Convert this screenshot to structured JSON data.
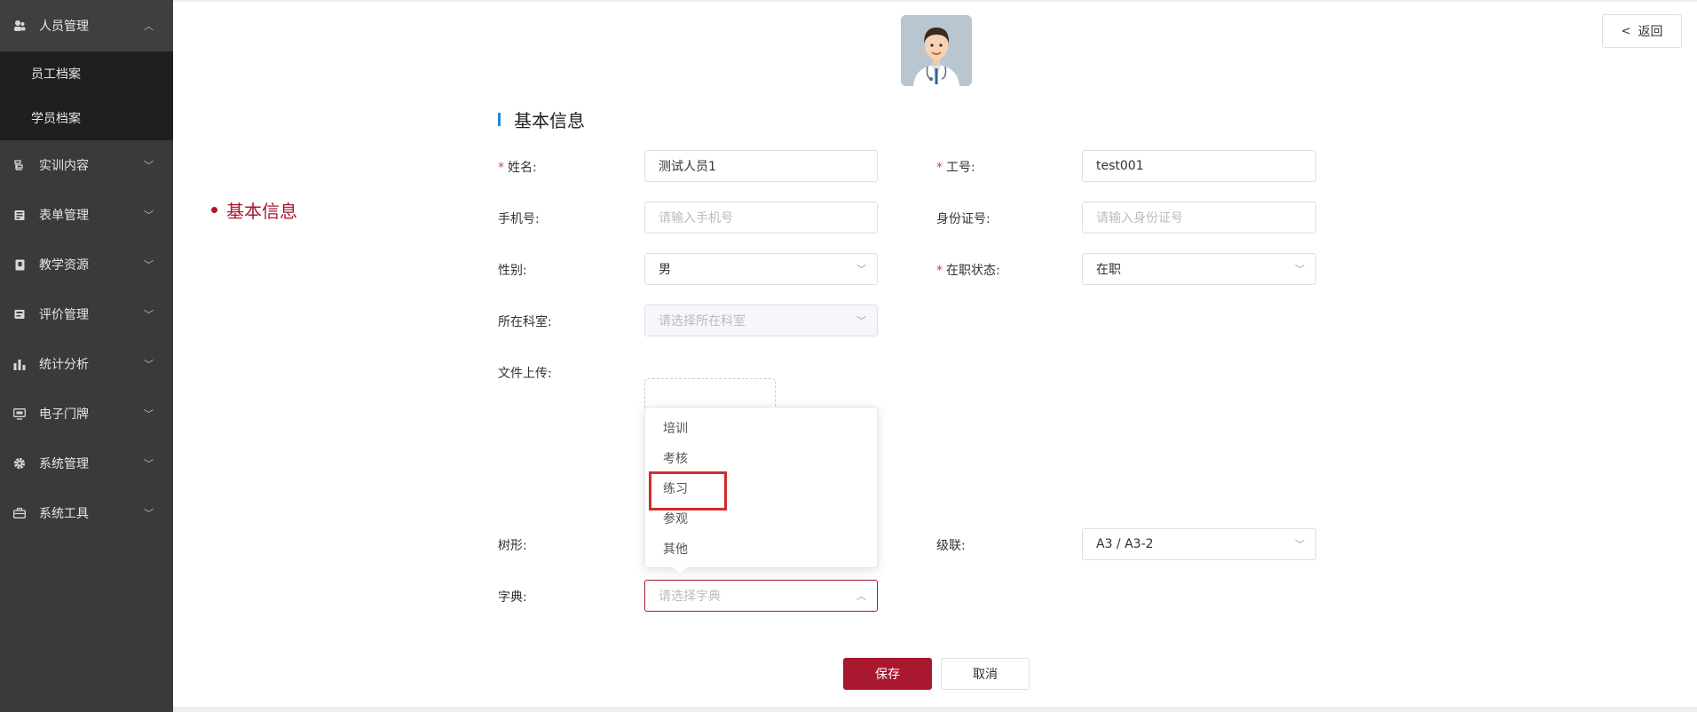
{
  "sidebar": {
    "items": [
      {
        "label": "人员管理",
        "icon": "users-icon",
        "open": true,
        "children": [
          {
            "label": "员工档案"
          },
          {
            "label": "学员档案"
          }
        ]
      },
      {
        "label": "实训内容",
        "icon": "content-icon"
      },
      {
        "label": "表单管理",
        "icon": "form-icon"
      },
      {
        "label": "教学资源",
        "icon": "resource-icon"
      },
      {
        "label": "评价管理",
        "icon": "evaluation-icon"
      },
      {
        "label": "统计分析",
        "icon": "bar-chart-icon"
      },
      {
        "label": "电子门牌",
        "icon": "monitor-icon"
      },
      {
        "label": "系统管理",
        "icon": "gear-icon"
      },
      {
        "label": "系统工具",
        "icon": "toolbox-icon"
      }
    ]
  },
  "header": {
    "back_label": "返回"
  },
  "anchor": {
    "label": "基本信息"
  },
  "section": {
    "title": "基本信息"
  },
  "form": {
    "name": {
      "label": "姓名:",
      "value": "测试人员1"
    },
    "job_no": {
      "label": "工号:",
      "value": "test001"
    },
    "phone": {
      "label": "手机号:",
      "placeholder": "请输入手机号"
    },
    "id_card": {
      "label": "身份证号:",
      "placeholder": "请输入身份证号"
    },
    "gender": {
      "label": "性别:",
      "value": "男"
    },
    "status": {
      "label": "在职状态:",
      "value": "在职"
    },
    "department": {
      "label": "所在科室:",
      "placeholder": "请选择所在科室"
    },
    "upload": {
      "label": "文件上传:"
    },
    "tree": {
      "label": "树形:"
    },
    "cascade": {
      "label": "级联:",
      "value": "A3 / A3-2"
    },
    "dict": {
      "label": "字典:",
      "placeholder": "请选择字典",
      "options": [
        "培训",
        "考核",
        "练习",
        "参观",
        "其他"
      ],
      "highlighted": "练习"
    }
  },
  "actions": {
    "save": "保存",
    "cancel": "取消"
  },
  "colors": {
    "accent": "#a8182e",
    "sidebar_bg": "#3a3a3a",
    "title_bar": "#1e88e5"
  }
}
